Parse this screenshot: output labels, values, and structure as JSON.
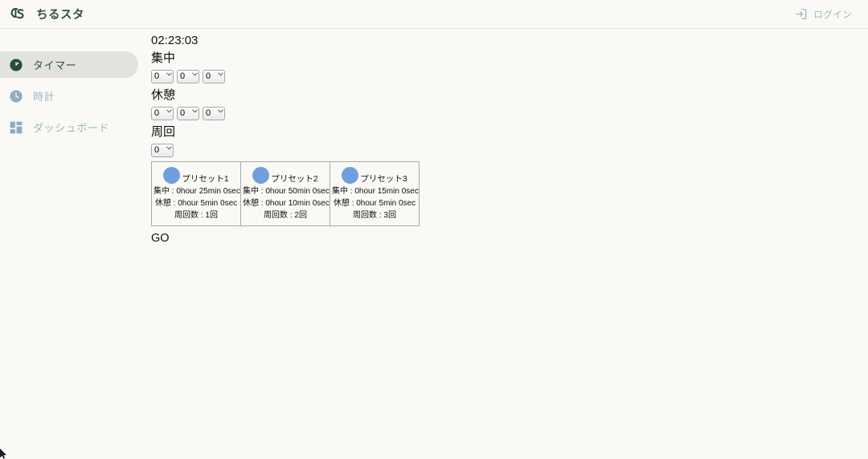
{
  "header": {
    "logo_name": "cs-monogram-logo",
    "brand_title": "ちるスタ",
    "login_label": "ログイン",
    "login_icon": "login-arrow-icon",
    "brand_color": "#2d5138",
    "muted_color": "#9cb7c2",
    "background": "#faf9f5"
  },
  "sidebar": {
    "items": [
      {
        "label": "タイマー",
        "icon": "timer-clock-icon",
        "active": true
      },
      {
        "label": "時計",
        "icon": "clock-icon",
        "active": false
      },
      {
        "label": "ダッシュボード",
        "icon": "dashboard-grid-icon",
        "active": false
      }
    ],
    "active_background": "#e2e2e0"
  },
  "main": {
    "timer_display": "02:23:03",
    "focus": {
      "label": "集中",
      "selects": [
        {
          "value": "0",
          "unit": "hour"
        },
        {
          "value": "0",
          "unit": "min"
        },
        {
          "value": "0",
          "unit": "sec"
        }
      ]
    },
    "rest": {
      "label": "休憩",
      "selects": [
        {
          "value": "0",
          "unit": "hour"
        },
        {
          "value": "0",
          "unit": "min"
        },
        {
          "value": "0",
          "unit": "sec"
        }
      ]
    },
    "laps": {
      "label": "周回",
      "selects": [
        {
          "value": "0",
          "unit": "count"
        }
      ]
    },
    "presets": [
      {
        "name": "プリセット1",
        "focus_line": "集中 : 0hour 25min 0sec",
        "rest_line": "休憩 : 0hour 5min 0sec",
        "laps_line": "周回数 : 1回",
        "dot_color": "#6fa0dd"
      },
      {
        "name": "プリセット2",
        "focus_line": "集中 : 0hour 50min 0sec",
        "rest_line": "休憩 : 0hour 10min 0sec",
        "laps_line": "周回数 : 2回",
        "dot_color": "#6fa0dd"
      },
      {
        "name": "プリセット3",
        "focus_line": "集中 : 0hour 15min 0sec",
        "rest_line": "休憩 : 0hour 5min 0sec",
        "laps_line": "周回数 : 3回",
        "dot_color": "#6fa0dd"
      }
    ],
    "go_label": "GO"
  }
}
